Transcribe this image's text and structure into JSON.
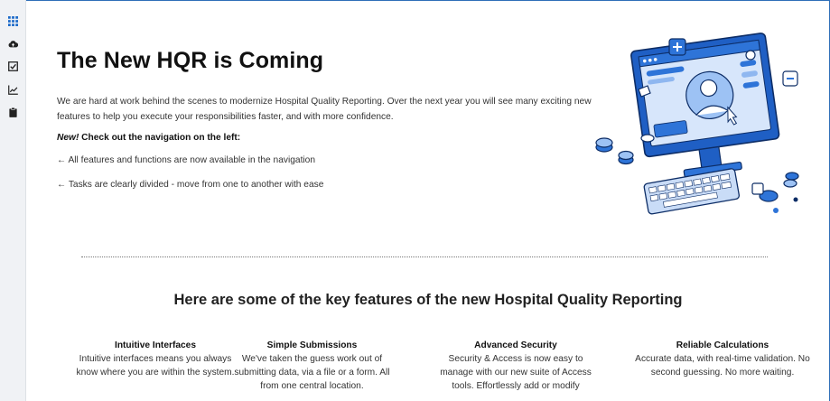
{
  "colors": {
    "accent": "#1b6ac9",
    "illustration_blue": "#2e74d8",
    "sidebar_bg": "#f0f2f5"
  },
  "sidebar": {
    "items": [
      {
        "icon": "grid-icon",
        "active": true
      },
      {
        "icon": "cloud-upload-icon",
        "active": false
      },
      {
        "icon": "checkbox-icon",
        "active": false
      },
      {
        "icon": "line-chart-icon",
        "active": false
      },
      {
        "icon": "clipboard-icon",
        "active": false
      }
    ]
  },
  "hero": {
    "title": "The New HQR is Coming",
    "intro": "We are hard at work behind the scenes to modernize Hospital Quality Reporting. Over the next year you will see many exciting new features to help you execute your responsibilities faster, and with more confidence.",
    "new_label": "New!",
    "new_text": " Check out the navigation on the left:",
    "bullets": [
      "← All features and functions are now available in the navigation",
      "← Tasks are clearly divided - move from one to another with ease"
    ]
  },
  "features_heading": "Here are some of the key features of the new Hospital Quality Reporting",
  "features": [
    {
      "name": "Intuitive Interfaces",
      "desc": "Intuitive interfaces means you always know where you are within the system."
    },
    {
      "name": "Simple Submissions",
      "desc": "We've taken the guess work out of submitting data, via a file or a form. All from one central location."
    },
    {
      "name": "Advanced Security",
      "desc": "Security & Access is now easy to manage with our new suite of Access tools. Effortlessly add or modify"
    },
    {
      "name": "Reliable Calculations",
      "desc": "Accurate data, with real-time validation. No second guessing. No more waiting."
    }
  ]
}
